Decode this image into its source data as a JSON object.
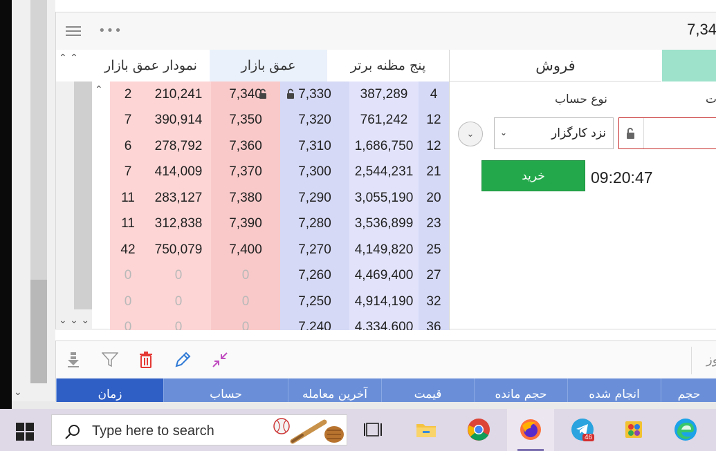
{
  "header": {
    "price": "7,34"
  },
  "tabs": [
    {
      "label": "نمودار عمق بازار"
    },
    {
      "label": "عمق بازار"
    },
    {
      "label": "پنج مظنه برتر"
    }
  ],
  "order_book": {
    "rows": [
      {
        "sell_count": "2",
        "sell_volume": "210,241",
        "sell_price": "7,340",
        "buy_price": "7,330",
        "buy_volume": "387,289",
        "buy_count": "4"
      },
      {
        "sell_count": "7",
        "sell_volume": "390,914",
        "sell_price": "7,350",
        "buy_price": "7,320",
        "buy_volume": "761,242",
        "buy_count": "12"
      },
      {
        "sell_count": "6",
        "sell_volume": "278,792",
        "sell_price": "7,360",
        "buy_price": "7,310",
        "buy_volume": "1,686,750",
        "buy_count": "12"
      },
      {
        "sell_count": "7",
        "sell_volume": "414,009",
        "sell_price": "7,370",
        "buy_price": "7,300",
        "buy_volume": "2,544,231",
        "buy_count": "21"
      },
      {
        "sell_count": "11",
        "sell_volume": "283,127",
        "sell_price": "7,380",
        "buy_price": "7,290",
        "buy_volume": "3,055,190",
        "buy_count": "20"
      },
      {
        "sell_count": "11",
        "sell_volume": "312,838",
        "sell_price": "7,390",
        "buy_price": "7,280",
        "buy_volume": "3,536,899",
        "buy_count": "23"
      },
      {
        "sell_count": "42",
        "sell_volume": "750,079",
        "sell_price": "7,400",
        "buy_price": "7,270",
        "buy_volume": "4,149,820",
        "buy_count": "25"
      },
      {
        "sell_count": "0",
        "sell_volume": "0",
        "sell_price": "0",
        "buy_price": "7,260",
        "buy_volume": "4,469,400",
        "buy_count": "27"
      },
      {
        "sell_count": "0",
        "sell_volume": "0",
        "sell_price": "0",
        "buy_price": "7,250",
        "buy_volume": "4,914,190",
        "buy_count": "32"
      },
      {
        "sell_count": "0",
        "sell_volume": "0",
        "sell_price": "0",
        "buy_price": "7,240",
        "buy_volume": "4,334,600",
        "buy_count": "36"
      }
    ]
  },
  "order_form": {
    "sell_tab": "فروش",
    "account_type_label": "نوع حساب",
    "partial_label": "ت",
    "account_type_value": "نزد کارگزار",
    "buy_button": "خرید",
    "time": "09:20:47"
  },
  "bottom_grid": {
    "toolbar_partial": "وز",
    "headers": [
      "زمان",
      "حساب",
      "آخرین معامله",
      "قیمت",
      "حجم مانده",
      "انجام شده",
      "حجم"
    ]
  },
  "taskbar": {
    "search_placeholder": "Type here to search",
    "telegram_badge": "46",
    "apps": [
      "task-view",
      "file-explorer",
      "chrome",
      "firefox",
      "telegram",
      "paint",
      "edge"
    ]
  },
  "colors": {
    "sell_bg": "#fdd5d5",
    "buy_bg": "#d5d9f6",
    "buy_button": "#23a94b",
    "grid_header": "#6a8fd8",
    "taskbar": "#dfd8e6"
  }
}
